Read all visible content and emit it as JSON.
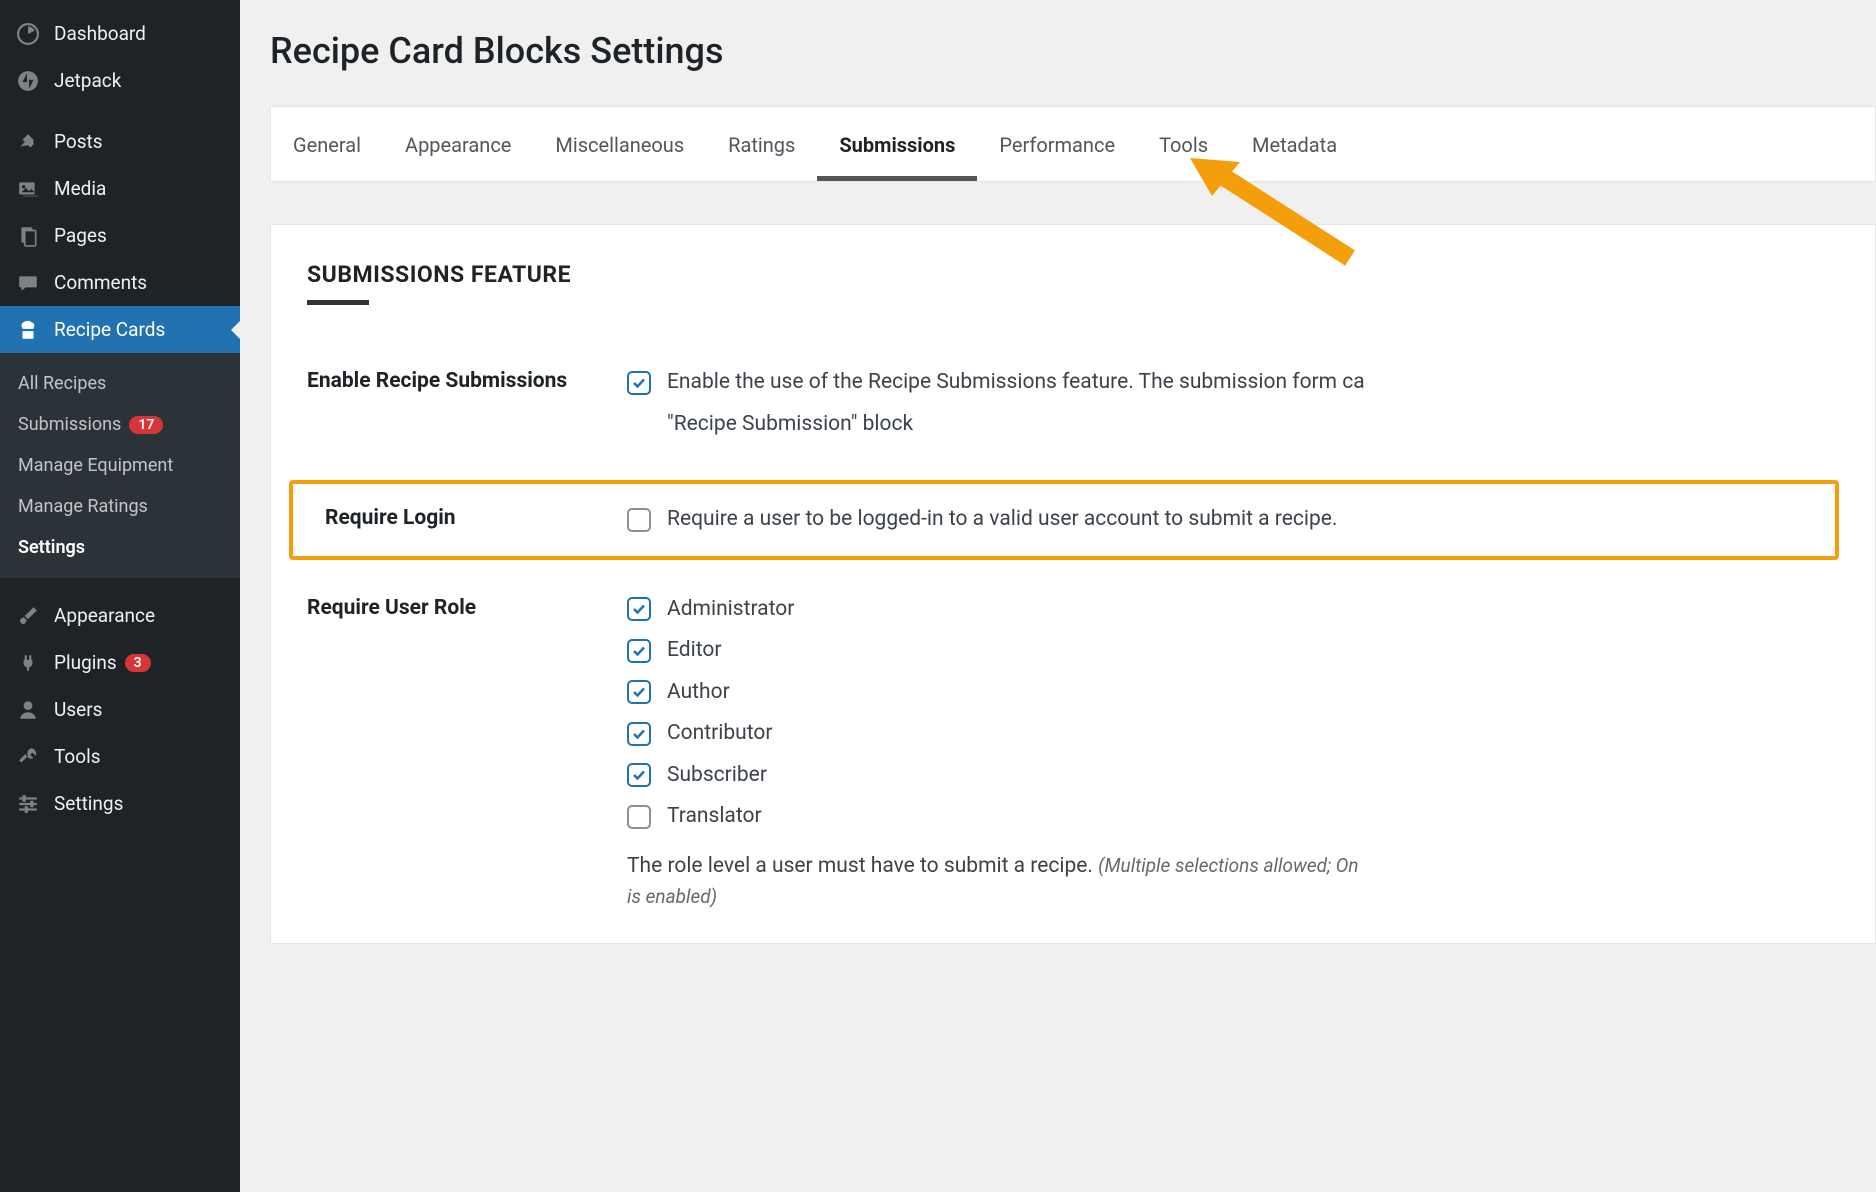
{
  "page": {
    "title": "Recipe Card Blocks Settings"
  },
  "sidebar": {
    "items": [
      {
        "label": "Dashboard",
        "icon": "dashboard"
      },
      {
        "label": "Jetpack",
        "icon": "jetpack"
      },
      {
        "label": "Posts",
        "icon": "pin"
      },
      {
        "label": "Media",
        "icon": "media"
      },
      {
        "label": "Pages",
        "icon": "pages"
      },
      {
        "label": "Comments",
        "icon": "comments"
      },
      {
        "label": "Recipe Cards",
        "icon": "recipe"
      },
      {
        "label": "Appearance",
        "icon": "brush"
      },
      {
        "label": "Plugins",
        "icon": "plug",
        "badge": "3"
      },
      {
        "label": "Users",
        "icon": "user"
      },
      {
        "label": "Tools",
        "icon": "wrench"
      },
      {
        "label": "Settings",
        "icon": "sliders"
      }
    ],
    "submenu": [
      {
        "label": "All Recipes"
      },
      {
        "label": "Submissions",
        "badge": "17"
      },
      {
        "label": "Manage Equipment"
      },
      {
        "label": "Manage Ratings"
      },
      {
        "label": "Settings",
        "current": true
      }
    ]
  },
  "tabs": [
    "General",
    "Appearance",
    "Miscellaneous",
    "Ratings",
    "Submissions",
    "Performance",
    "Tools",
    "Metadata"
  ],
  "active_tab": "Submissions",
  "section": {
    "heading": "SUBMISSIONS FEATURE"
  },
  "settings": {
    "enable": {
      "label": "Enable Recipe Submissions",
      "checked": true,
      "text": "Enable the use of the Recipe Submissions feature. The submission form ca",
      "text2": "\"Recipe Submission\" block"
    },
    "require_login": {
      "label": "Require Login",
      "checked": false,
      "text": "Require a user to be logged-in to a valid user account to submit a recipe."
    },
    "require_role": {
      "label": "Require User Role",
      "roles": [
        {
          "label": "Administrator",
          "checked": true
        },
        {
          "label": "Editor",
          "checked": true
        },
        {
          "label": "Author",
          "checked": true
        },
        {
          "label": "Contributor",
          "checked": true
        },
        {
          "label": "Subscriber",
          "checked": true
        },
        {
          "label": "Translator",
          "checked": false
        }
      ],
      "help": "The role level a user must have to submit a recipe.",
      "hint": "(Multiple selections allowed; On",
      "hint2": "is enabled)"
    }
  }
}
